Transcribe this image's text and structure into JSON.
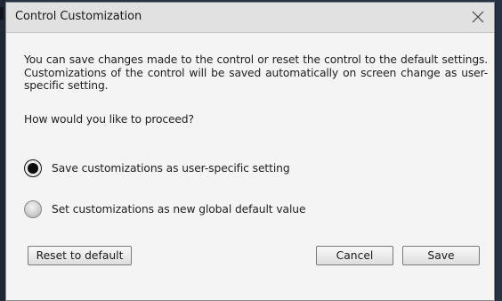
{
  "window": {
    "title": "Control Customization",
    "close_icon": "close-icon"
  },
  "content": {
    "description": "You can save changes made to the control or reset the control to the default settings. Customizations of the control will be saved automatically on screen change as user-specific setting.",
    "question": "How would you like to proceed?"
  },
  "options": [
    {
      "label": "Save customizations as user-specific setting",
      "selected": true
    },
    {
      "label": "Set customizations as new global default value",
      "selected": false
    }
  ],
  "buttons": {
    "reset_label": "Reset to default",
    "cancel_label": "Cancel",
    "save_label": "Save"
  }
}
